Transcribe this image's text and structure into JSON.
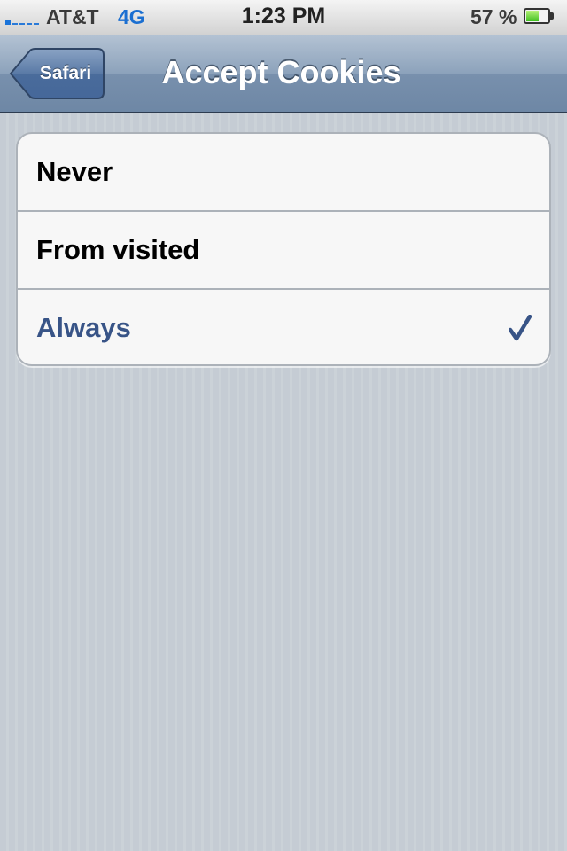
{
  "status_bar": {
    "carrier": "AT&T",
    "network": "4G",
    "time": "1:23 PM",
    "battery_percent_label": "57 %",
    "battery_level": 0.57,
    "signal_bars_filled": 1,
    "signal_bars_total": 5,
    "signal_icon": "signal-strength-icon",
    "battery_icon": "battery-icon"
  },
  "nav_bar": {
    "back_label": "Safari",
    "title": "Accept Cookies"
  },
  "options": [
    {
      "label": "Never",
      "selected": false
    },
    {
      "label": "From visited",
      "selected": false
    },
    {
      "label": "Always",
      "selected": true
    }
  ],
  "colors": {
    "selected_text": "#385487",
    "nav_bar": "#8ca2bb",
    "background": "#c5ccd4",
    "network_blue": "#1b6fd1",
    "battery_green": "#3ec01f"
  }
}
